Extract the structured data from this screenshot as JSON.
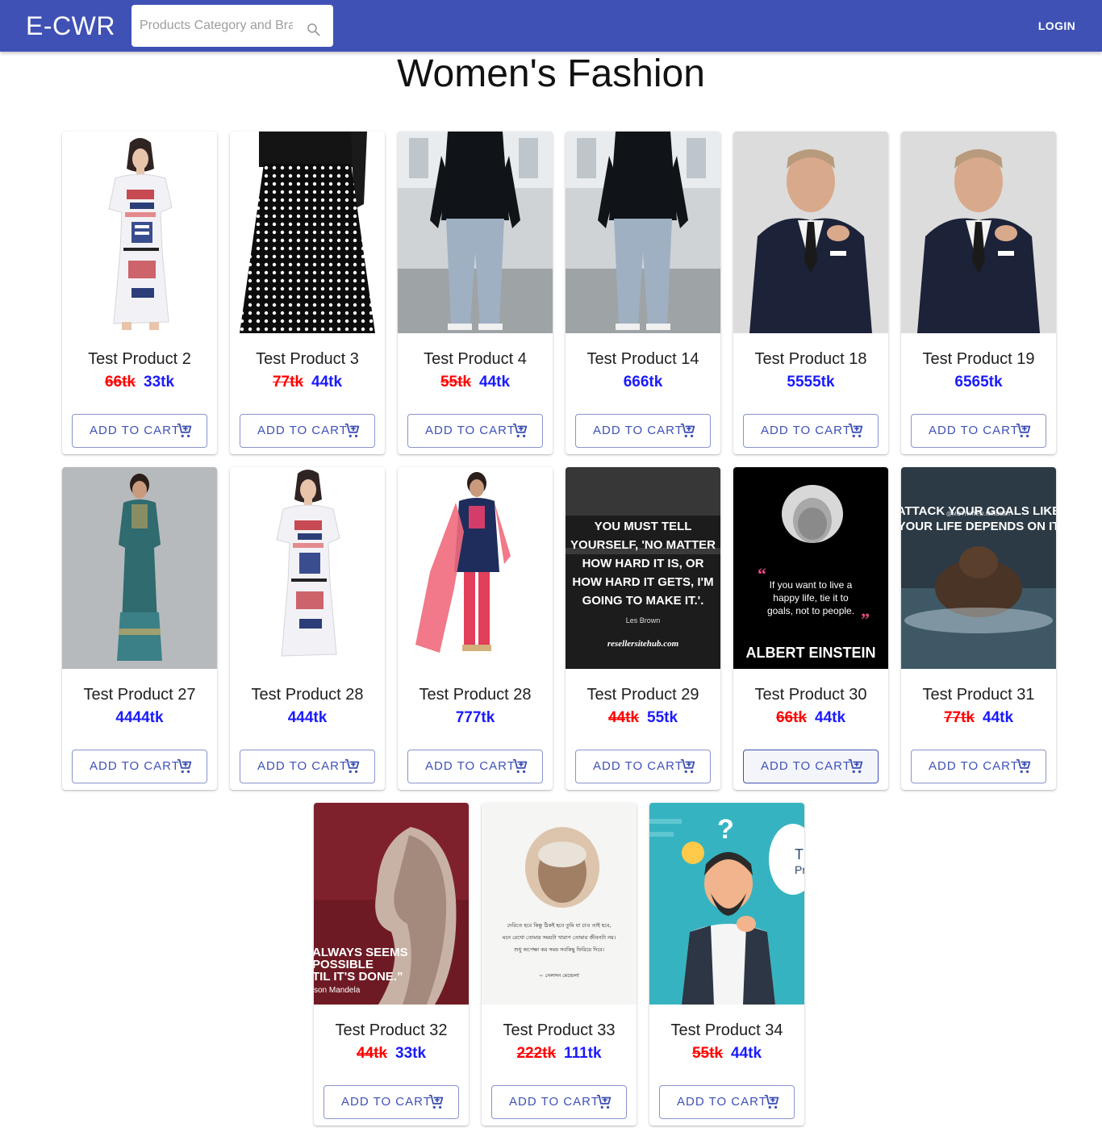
{
  "header": {
    "brand": "E-CWR",
    "search_placeholder": "Products Category and Brand",
    "search_icon": "search-icon",
    "login_label": "LOGIN",
    "bar_color": "#3f51b5"
  },
  "page": {
    "title": "Women's Fashion"
  },
  "colors": {
    "old_price": "#ff0000",
    "new_price": "#1a1aff",
    "accent": "#3f51b5"
  },
  "products": [
    {
      "name": "Test Product 2",
      "old_price": "66tk",
      "price": "33tk",
      "image": "woman-white-printed-dress",
      "button": "ADD TO CART",
      "button_icon": "add-shopping-cart-icon"
    },
    {
      "name": "Test Product 3",
      "old_price": "77tk",
      "price": "44tk",
      "image": "black-polka-dot-skirt",
      "button": "ADD TO CART",
      "button_icon": "add-shopping-cart-icon"
    },
    {
      "name": "Test Product 4",
      "old_price": "55tk",
      "price": "44tk",
      "image": "man-black-shirt-grey-pants",
      "button": "ADD TO CART",
      "button_icon": "add-shopping-cart-icon"
    },
    {
      "name": "Test Product 14",
      "old_price": "",
      "price": "666tk",
      "image": "man-black-shirt-grey-pants",
      "button": "ADD TO CART",
      "button_icon": "add-shopping-cart-icon"
    },
    {
      "name": "Test Product 18",
      "old_price": "",
      "price": "5555tk",
      "image": "man-navy-suit",
      "button": "ADD TO CART",
      "button_icon": "add-shopping-cart-icon"
    },
    {
      "name": "Test Product 19",
      "old_price": "",
      "price": "6565tk",
      "image": "man-navy-suit",
      "button": "ADD TO CART",
      "button_icon": "add-shopping-cart-icon"
    },
    {
      "name": "Test Product 27",
      "old_price": "",
      "price": "4444tk",
      "image": "woman-teal-long-dress",
      "button": "ADD TO CART",
      "button_icon": "add-shopping-cart-icon"
    },
    {
      "name": "Test Product 28",
      "old_price": "",
      "price": "444tk",
      "image": "woman-white-printed-dress",
      "button": "ADD TO CART",
      "button_icon": "add-shopping-cart-icon"
    },
    {
      "name": "Test Product 28",
      "old_price": "",
      "price": "777tk",
      "image": "woman-navy-salwar-kameez",
      "button": "ADD TO CART",
      "button_icon": "add-shopping-cart-icon"
    },
    {
      "name": "Test Product 29",
      "old_price": "44tk",
      "price": "55tk",
      "image": "quote-poster-bridge",
      "poster": {
        "lines": [
          "YOU MUST TELL",
          "YOURSELF, 'NO MATTER",
          "HOW HARD IT IS, OR",
          "HOW HARD IT GETS, I'M",
          "GOING TO MAKE IT.'."
        ],
        "author": "Les Brown",
        "site": "resellersitehub.com"
      },
      "button": "ADD TO CART",
      "button_icon": "add-shopping-cart-icon"
    },
    {
      "name": "Test Product 30",
      "old_price": "66tk",
      "price": "44tk",
      "image": "quote-poster-einstein",
      "poster": {
        "lines": [
          "If you want to live a",
          "happy life, tie it to",
          "goals, not to people."
        ],
        "author": "ALBERT EINSTEIN"
      },
      "button": "ADD TO CART",
      "button_icon": "add-shopping-cart-icon"
    },
    {
      "name": "Test Product 31",
      "old_price": "77tk",
      "price": "44tk",
      "image": "quote-poster-bear",
      "poster": {
        "lines": [
          "ATTACK YOUR GOALS LIKE",
          "YOUR LIFE DEPENDS ON IT"
        ],
        "handle": "@MOTIVATED.MINDSET"
      },
      "button": "ADD TO CART",
      "button_icon": "add-shopping-cart-icon"
    },
    {
      "name": "Test Product 32",
      "old_price": "44tk",
      "price": "33tk",
      "image": "quote-poster-mandela",
      "poster": {
        "lines": [
          "ALWAYS SEEMS",
          "POSSIBLE",
          "TIL IT'S DONE.”"
        ],
        "author": "son Mandela"
      },
      "button": "ADD TO CART",
      "button_icon": "add-shopping-cart-icon"
    },
    {
      "name": "Test Product 33",
      "old_price": "222tk",
      "price": "111tk",
      "image": "quote-poster-mandela-sketch",
      "poster": {
        "lines": [
          "দেরিতে হবে কিন্তু ঠিকই হবে তুমি যা চাও তাই হবে,",
          "মনে রেখো তোমার সময়টা খারাপ তোমার জীবনটা নয়।",
          "শুধু অপেক্ষা কর সময় সবকিছু ফিরিয়ে দিবে।"
        ],
        "author": "~ নেলসন মেন্ডেলা"
      },
      "button": "ADD TO CART",
      "button_icon": "add-shopping-cart-icon"
    },
    {
      "name": "Test Product 34",
      "old_price": "55tk",
      "price": "44tk",
      "image": "thinking-man-illustration",
      "poster": {
        "lines": [
          "T",
          "Pr"
        ]
      },
      "button": "ADD TO CART",
      "button_icon": "add-shopping-cart-icon"
    }
  ]
}
